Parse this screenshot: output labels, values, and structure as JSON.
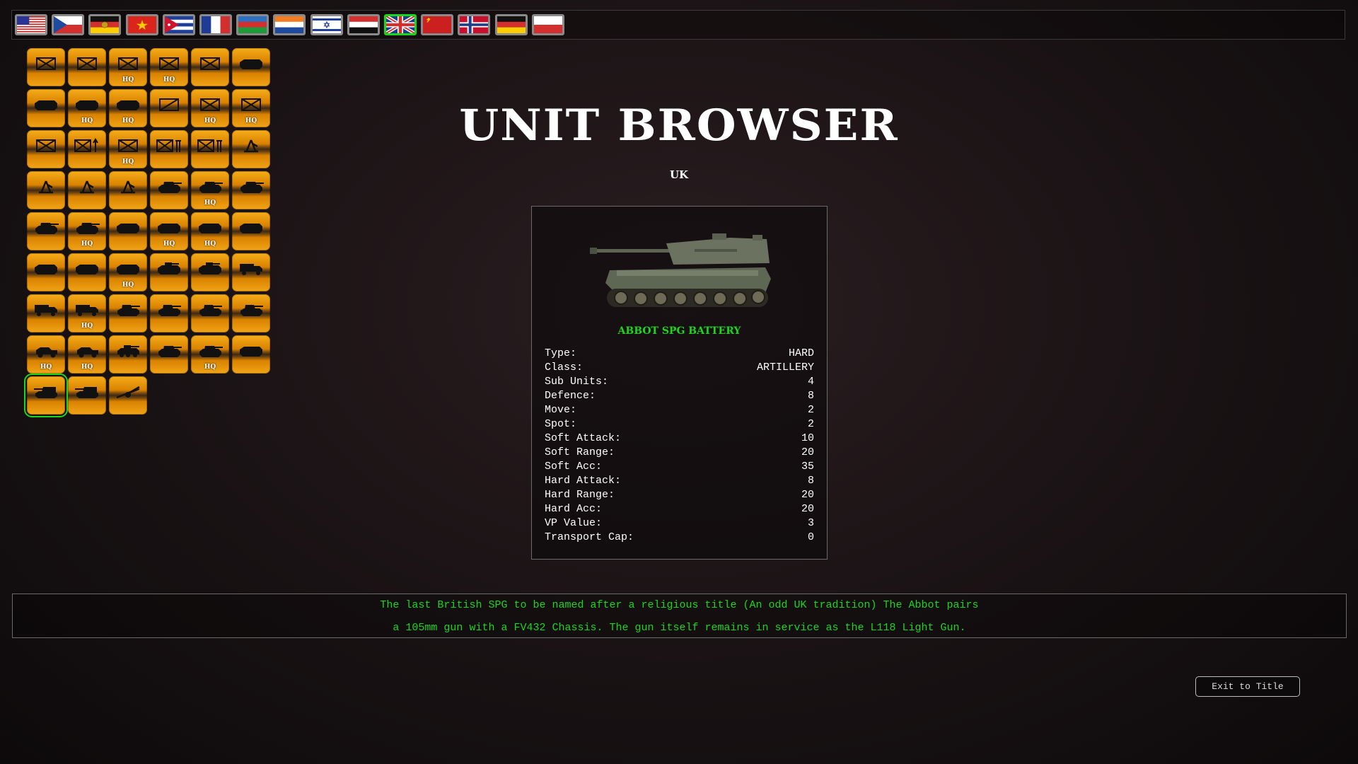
{
  "nations": [
    {
      "code": "us",
      "icon": "flag-usa-icon"
    },
    {
      "code": "cz",
      "icon": "flag-czechoslovakia-icon"
    },
    {
      "code": "ddr",
      "icon": "flag-east-germany-icon"
    },
    {
      "code": "vn",
      "icon": "flag-vietnam-icon"
    },
    {
      "code": "cu",
      "icon": "flag-cuba-icon"
    },
    {
      "code": "fr",
      "icon": "flag-france-icon"
    },
    {
      "code": "az",
      "icon": "flag-azerbaijan-icon"
    },
    {
      "code": "nl",
      "icon": "flag-netherlands-icon"
    },
    {
      "code": "il",
      "icon": "flag-israel-icon"
    },
    {
      "code": "ye",
      "icon": "flag-yemen-icon"
    },
    {
      "code": "uk",
      "icon": "flag-uk-icon",
      "selected": true
    },
    {
      "code": "su",
      "icon": "flag-soviet-union-icon"
    },
    {
      "code": "no",
      "icon": "flag-norway-icon"
    },
    {
      "code": "de",
      "icon": "flag-germany-icon"
    },
    {
      "code": "pl",
      "icon": "flag-poland-icon"
    }
  ],
  "units": [
    {
      "icon": "infantry-icon",
      "hq": ""
    },
    {
      "icon": "infantry-icon",
      "hq": ""
    },
    {
      "icon": "infantry-icon",
      "hq": "HQ"
    },
    {
      "icon": "infantry-icon",
      "hq": "HQ"
    },
    {
      "icon": "infantry-icon",
      "hq": ""
    },
    {
      "icon": "apc-icon",
      "hq": ""
    },
    {
      "icon": "apc-icon",
      "hq": ""
    },
    {
      "icon": "apc-icon",
      "hq": "HQ"
    },
    {
      "icon": "apc-icon",
      "hq": "HQ"
    },
    {
      "icon": "recon-icon",
      "hq": ""
    },
    {
      "icon": "infantry-icon",
      "hq": "HQ"
    },
    {
      "icon": "infantry-icon",
      "hq": "HQ"
    },
    {
      "icon": "infantry-icon",
      "hq": ""
    },
    {
      "icon": "infantry-atgm-icon",
      "hq": ""
    },
    {
      "icon": "infantry-icon",
      "hq": "HQ"
    },
    {
      "icon": "infantry-engineer-icon",
      "hq": ""
    },
    {
      "icon": "infantry-engineer-icon",
      "hq": ""
    },
    {
      "icon": "mortar-icon",
      "hq": ""
    },
    {
      "icon": "mortar-icon",
      "hq": ""
    },
    {
      "icon": "mortar-icon",
      "hq": ""
    },
    {
      "icon": "mortar-icon",
      "hq": ""
    },
    {
      "icon": "tank-icon",
      "hq": ""
    },
    {
      "icon": "tank-icon",
      "hq": "HQ"
    },
    {
      "icon": "tank-icon",
      "hq": ""
    },
    {
      "icon": "tank-icon",
      "hq": ""
    },
    {
      "icon": "tank-icon",
      "hq": "HQ"
    },
    {
      "icon": "apc-icon",
      "hq": ""
    },
    {
      "icon": "apc-icon",
      "hq": "HQ"
    },
    {
      "icon": "apc-icon",
      "hq": "HQ"
    },
    {
      "icon": "apc-icon",
      "hq": ""
    },
    {
      "icon": "apc-icon",
      "hq": ""
    },
    {
      "icon": "apc-icon",
      "hq": ""
    },
    {
      "icon": "apc-icon",
      "hq": "HQ"
    },
    {
      "icon": "ifv-icon",
      "hq": ""
    },
    {
      "icon": "ifv-icon",
      "hq": ""
    },
    {
      "icon": "truck-icon",
      "hq": ""
    },
    {
      "icon": "truck-icon",
      "hq": ""
    },
    {
      "icon": "truck-icon",
      "hq": "HQ"
    },
    {
      "icon": "light-tank-icon",
      "hq": ""
    },
    {
      "icon": "light-tank-icon",
      "hq": ""
    },
    {
      "icon": "light-tank-icon",
      "hq": ""
    },
    {
      "icon": "light-tank-icon",
      "hq": ""
    },
    {
      "icon": "jeep-icon",
      "hq": "HQ"
    },
    {
      "icon": "jeep-icon",
      "hq": "HQ"
    },
    {
      "icon": "armored-car-icon",
      "hq": ""
    },
    {
      "icon": "tank-icon",
      "hq": ""
    },
    {
      "icon": "tank-icon",
      "hq": "HQ"
    },
    {
      "icon": "apc-icon",
      "hq": ""
    },
    {
      "icon": "spg-icon",
      "hq": "",
      "selected": true
    },
    {
      "icon": "spg-icon",
      "hq": ""
    },
    {
      "icon": "towed-gun-icon",
      "hq": ""
    }
  ],
  "title": "UNIT BROWSER",
  "nation_label": "UK",
  "unit": {
    "name": "ABBOT SPG BATTERY",
    "stats": [
      {
        "label": "Type:",
        "value": "HARD"
      },
      {
        "label": "Class:",
        "value": "ARTILLERY"
      },
      {
        "label": "Sub Units:",
        "value": "4"
      },
      {
        "label": "Defence:",
        "value": "8"
      },
      {
        "label": "Move:",
        "value": "2"
      },
      {
        "label": "Spot:",
        "value": "2"
      },
      {
        "label": "Soft Attack:",
        "value": "10"
      },
      {
        "label": "Soft Range:",
        "value": "20"
      },
      {
        "label": "Soft Acc:",
        "value": "35"
      },
      {
        "label": "Hard Attack:",
        "value": "8"
      },
      {
        "label": "Hard Range:",
        "value": "20"
      },
      {
        "label": "Hard Acc:",
        "value": "20"
      },
      {
        "label": "VP Value:",
        "value": "3"
      },
      {
        "label": "Transport Cap:",
        "value": "0"
      }
    ]
  },
  "description": {
    "line1": "The last British SPG to be named after a religious title (An odd UK tradition) The Abbot pairs",
    "line2": "a 105mm gun with a FV432 Chassis. The gun itself remains in service as the L118 Light Gun."
  },
  "exit_label": "Exit to Title",
  "colors": {
    "accent_green": "#19d719",
    "tile_orange": "#f1a417"
  }
}
